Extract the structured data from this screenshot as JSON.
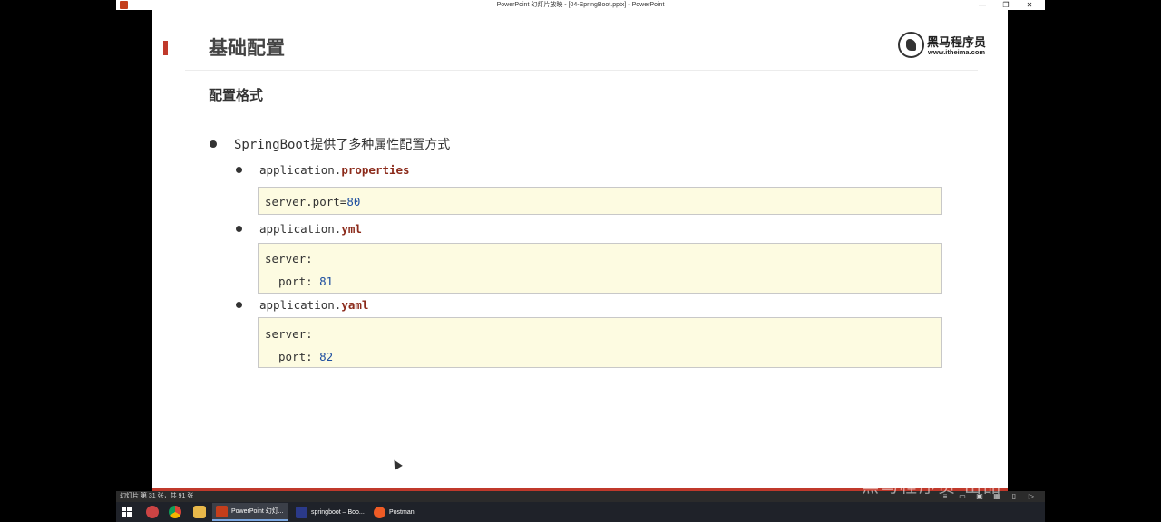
{
  "window": {
    "title": "PowerPoint 幻灯片放映 - [04-SpringBoot.pptx] - PowerPoint",
    "controls": [
      "—",
      "❐",
      "✕"
    ]
  },
  "slide": {
    "title": "基础配置",
    "logo": {
      "name": "黑马程序员",
      "url": "www.itheima.com"
    },
    "subtitle": "配置格式",
    "bullet": "SpringBoot提供了多种属性配置方式",
    "formats": [
      {
        "prefix": "application.",
        "ext": "properties",
        "code": [
          {
            "key": "server.port=",
            "value": "80"
          }
        ]
      },
      {
        "prefix": "application.",
        "ext": "yml",
        "code": [
          {
            "key": "server:",
            "value": ""
          },
          {
            "key": "port: ",
            "value": "81"
          }
        ]
      },
      {
        "prefix": "application.",
        "ext": "yaml",
        "code": [
          {
            "key": "server:",
            "value": ""
          },
          {
            "key": "port: ",
            "value": "82"
          }
        ]
      }
    ]
  },
  "statusbar": {
    "text": "幻灯片 第 31 张，共 91 张"
  },
  "watermark": "黑马程序员 出品",
  "taskbar": {
    "apps": [
      {
        "label": "PowerPoint 幻灯...",
        "color": "#c43e1c",
        "active": true
      },
      {
        "label": "springboot – Boo...",
        "color": "#2b3a8a",
        "active": false
      },
      {
        "label": "Postman",
        "color": "#ef5b25",
        "active": false
      }
    ]
  },
  "colors": {
    "accent": "#c0392b",
    "keyword": "#8b2a1a",
    "number": "#1f4fa0",
    "code_bg": "#fdfbe1"
  }
}
